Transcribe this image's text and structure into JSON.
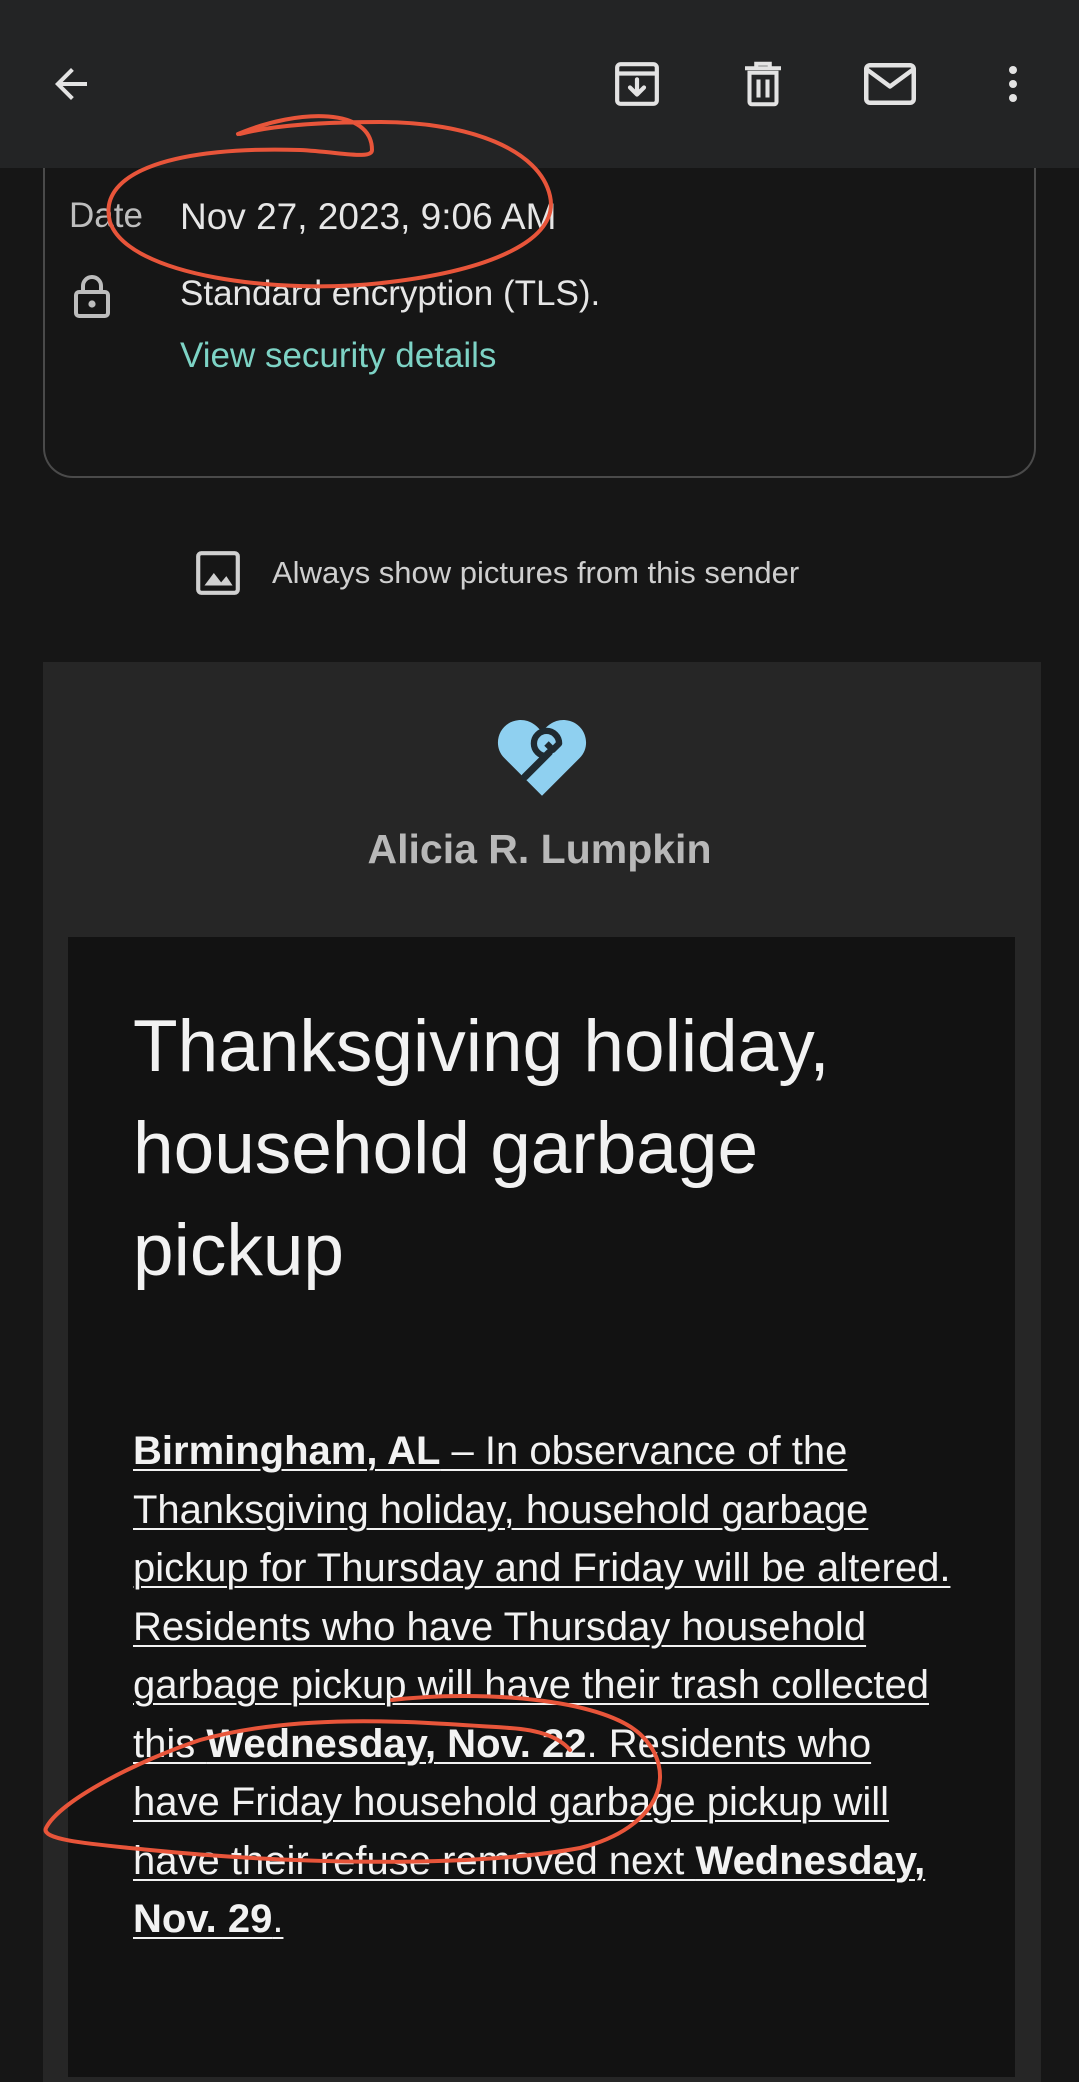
{
  "toolbar": {
    "back_icon": "arrow-left-icon",
    "archive_icon": "archive-icon",
    "delete_icon": "trash-icon",
    "mark_unread_icon": "mail-icon",
    "more_icon": "more-vert-icon"
  },
  "details": {
    "date_label": "Date",
    "date_value": "Nov 27, 2023, 9:06 AM",
    "lock_icon": "lock-icon",
    "encryption_text": "Standard encryption (TLS).",
    "security_link": "View security details"
  },
  "images_prompt": {
    "icon": "image-icon",
    "label": "Always show pictures from this sender"
  },
  "email": {
    "logo_icon": "heart-wrench-icon",
    "sender_name": "Alicia R. Lumpkin",
    "headline": "Thanksgiving holiday, household garbage pickup",
    "body": {
      "location": "Birmingham, AL",
      "text_1": " – In observance of the Thanksgiving holiday, household garbage pickup for Thursday and Friday will be altered. Residents who have Thursday household garbage pickup will have their trash collected this ",
      "date_1": "Wednesday, Nov. 22",
      "text_2": ". Residents who have Friday household garbage pickup will have their refuse removed next ",
      "date_2": "Wednesday, Nov. 29",
      "text_3": ". "
    }
  },
  "colors": {
    "toolbar_bg": "#232425",
    "page_bg": "#161616",
    "link": "#7dd3c5",
    "annotation": "#e8553a",
    "logo": "#8fd0f0"
  }
}
